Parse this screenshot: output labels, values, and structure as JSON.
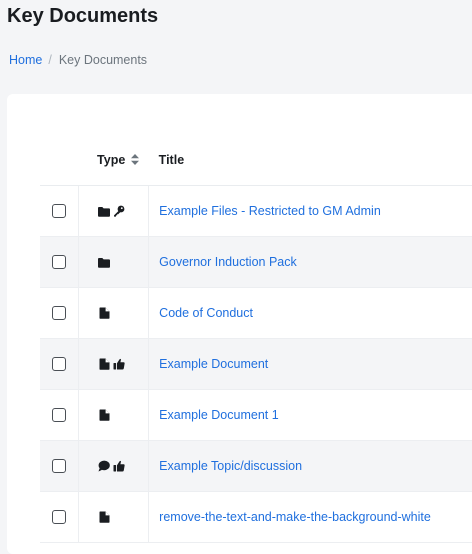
{
  "page": {
    "title": "Key Documents"
  },
  "breadcrumb": {
    "home": "Home",
    "separator": "/",
    "current": "Key Documents"
  },
  "table": {
    "headers": {
      "type": "Type",
      "title": "Title"
    },
    "rows": [
      {
        "title": "Example Files - Restricted to GM Admin",
        "icons": [
          "folder-icon",
          "key-icon"
        ]
      },
      {
        "title": "Governor Induction Pack",
        "icons": [
          "folder-icon"
        ]
      },
      {
        "title": "Code of Conduct",
        "icons": [
          "file-icon"
        ]
      },
      {
        "title": "Example Document",
        "icons": [
          "file-icon",
          "thumbs-up-icon"
        ]
      },
      {
        "title": "Example Document 1",
        "icons": [
          "file-icon"
        ]
      },
      {
        "title": "Example Topic/discussion",
        "icons": [
          "comment-icon",
          "thumbs-up-icon"
        ]
      },
      {
        "title": "remove-the-text-and-make-the-background-white",
        "icons": [
          "file-icon"
        ]
      }
    ]
  },
  "colors": {
    "link": "#1f6fde",
    "stripe": "#f4f5f7",
    "page_background": "#f4f5f7",
    "card": "#ffffff"
  }
}
